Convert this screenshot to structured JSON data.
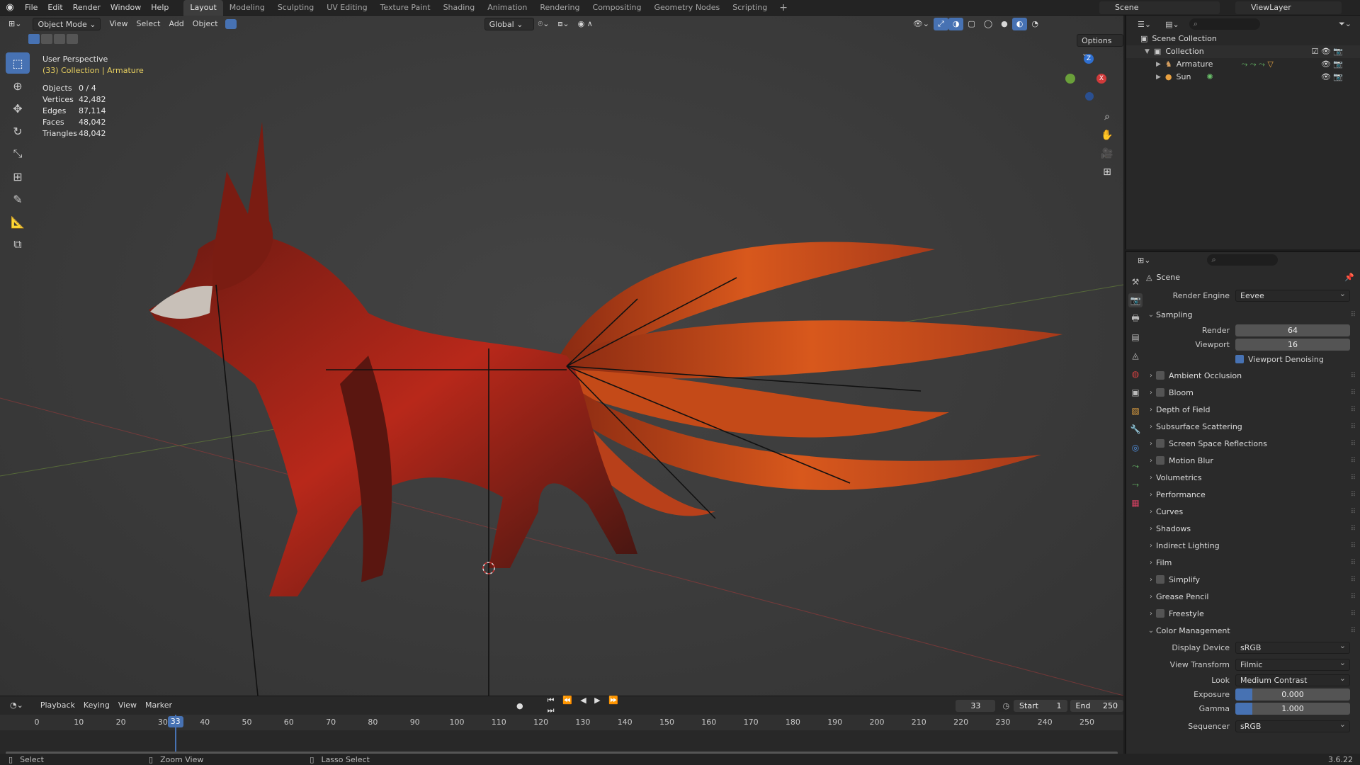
{
  "menu": [
    "File",
    "Edit",
    "Render",
    "Window",
    "Help"
  ],
  "workspaces": [
    "Layout",
    "Modeling",
    "Sculpting",
    "UV Editing",
    "Texture Paint",
    "Shading",
    "Animation",
    "Rendering",
    "Compositing",
    "Geometry Nodes",
    "Scripting"
  ],
  "active_workspace": "Layout",
  "scene_name": "Scene",
  "view_layer": "ViewLayer",
  "viewport": {
    "mode": "Object Mode",
    "menus": [
      "View",
      "Select",
      "Add",
      "Object"
    ],
    "orientation": "Global",
    "options_label": "Options",
    "perspective": "User Perspective",
    "collection_info": "(33) Collection | Armature",
    "stats": [
      {
        "label": "Objects",
        "value": "0 / 4"
      },
      {
        "label": "Vertices",
        "value": "42,482"
      },
      {
        "label": "Edges",
        "value": "87,114"
      },
      {
        "label": "Faces",
        "value": "48,042"
      },
      {
        "label": "Triangles",
        "value": "48,042"
      }
    ],
    "gizmo": {
      "z": "Z",
      "x": "X"
    }
  },
  "outliner": {
    "scene_collection": "Scene Collection",
    "collection": "Collection",
    "items": [
      "Armature",
      "Sun"
    ]
  },
  "properties": {
    "header": "Scene",
    "render_engine_label": "Render Engine",
    "render_engine": "Eevee",
    "sampling_label": "Sampling",
    "render_label": "Render",
    "render_samples": "64",
    "viewport_label": "Viewport",
    "viewport_samples": "16",
    "viewport_denoising": "Viewport Denoising",
    "panels": [
      {
        "label": "Ambient Occlusion",
        "checkbox": true
      },
      {
        "label": "Bloom",
        "checkbox": true
      },
      {
        "label": "Depth of Field",
        "checkbox": false
      },
      {
        "label": "Subsurface Scattering",
        "checkbox": false
      },
      {
        "label": "Screen Space Reflections",
        "checkbox": true
      },
      {
        "label": "Motion Blur",
        "checkbox": true
      },
      {
        "label": "Volumetrics",
        "checkbox": false
      },
      {
        "label": "Performance",
        "checkbox": false
      },
      {
        "label": "Curves",
        "checkbox": false
      },
      {
        "label": "Shadows",
        "checkbox": false
      },
      {
        "label": "Indirect Lighting",
        "checkbox": false
      },
      {
        "label": "Film",
        "checkbox": false
      },
      {
        "label": "Simplify",
        "checkbox": true
      },
      {
        "label": "Grease Pencil",
        "checkbox": false
      },
      {
        "label": "Freestyle",
        "checkbox": true
      }
    ],
    "color_management": "Color Management",
    "display_device_label": "Display Device",
    "display_device": "sRGB",
    "view_transform_label": "View Transform",
    "view_transform": "Filmic",
    "look_label": "Look",
    "look": "Medium Contrast",
    "exposure_label": "Exposure",
    "exposure": "0.000",
    "gamma_label": "Gamma",
    "gamma": "1.000",
    "sequencer_label": "Sequencer",
    "sequencer": "sRGB"
  },
  "timeline": {
    "menus": [
      "Playback",
      "Keying",
      "View",
      "Marker"
    ],
    "current_frame": "33",
    "start_label": "Start",
    "start": "1",
    "end_label": "End",
    "end": "250",
    "ticks": [
      "0",
      "10",
      "20",
      "30",
      "40",
      "50",
      "60",
      "70",
      "80",
      "90",
      "100",
      "110",
      "120",
      "130",
      "140",
      "150",
      "160",
      "170",
      "180",
      "190",
      "200",
      "210",
      "220",
      "230",
      "240",
      "250"
    ]
  },
  "statusbar": {
    "select": "Select",
    "zoom_view": "Zoom View",
    "lasso_select": "Lasso Select",
    "version": "3.6.22"
  },
  "colors": {
    "accent": "#4772b3",
    "fur_dark": "#3a1410",
    "fur_red": "#c8301a",
    "fur_orange": "#e8641a"
  }
}
